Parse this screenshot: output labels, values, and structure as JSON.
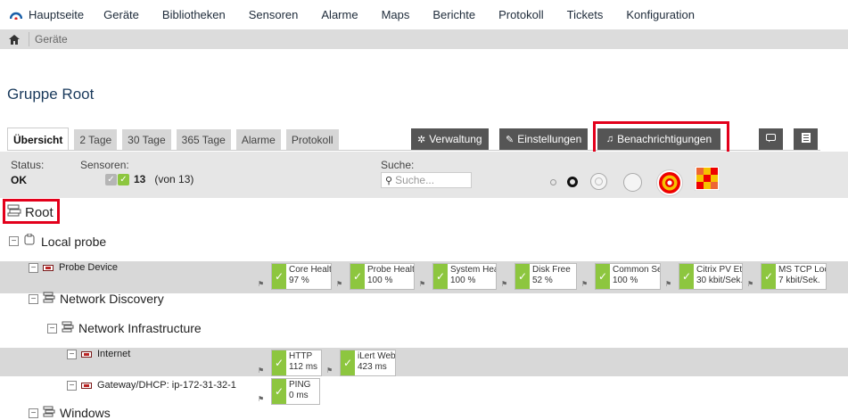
{
  "nav": {
    "items": [
      "Hauptseite",
      "Geräte",
      "Bibliotheken",
      "Sensoren",
      "Alarme",
      "Maps",
      "Berichte",
      "Protokoll",
      "Tickets",
      "Konfiguration"
    ]
  },
  "breadcrumb": {
    "current": "Geräte"
  },
  "page": {
    "title": "Gruppe Root"
  },
  "tabs": [
    {
      "label": "Übersicht"
    },
    {
      "label": "2 Tage"
    },
    {
      "label": "30 Tage"
    },
    {
      "label": "365 Tage"
    },
    {
      "label": "Alarme"
    },
    {
      "label": "Protokoll"
    }
  ],
  "actions": {
    "verwaltung": "Verwaltung",
    "einstellungen": "Einstellungen",
    "benachrichtigungen": "Benachrichtigungen"
  },
  "status": {
    "status_label": "Status:",
    "status_value": "OK",
    "sensors_label": "Sensoren:",
    "sensors_count": "13",
    "sensors_total": "(von 13)",
    "search_label": "Suche:",
    "search_placeholder": "Suche..."
  },
  "tree": {
    "root": "Root",
    "local_probe": "Local probe",
    "probe_device": "Probe Device",
    "network_discovery": "Network Discovery",
    "network_infrastructure": "Network Infrastructure",
    "internet": "Internet",
    "gateway": "Gateway/DHCP: ip-172-31-32-1",
    "windows": "Windows"
  },
  "sensors": {
    "probe_device": [
      {
        "name": "Core Health",
        "value": "97 %"
      },
      {
        "name": "Probe Health",
        "value": "100 %"
      },
      {
        "name": "System Health",
        "value": "100 %"
      },
      {
        "name": "Disk Free",
        "value": "52 %"
      },
      {
        "name": "Common Sea...",
        "value": "100 %"
      },
      {
        "name": "Citrix PV Eth...",
        "value": "30 kbit/Sek."
      },
      {
        "name": "MS TCP Loop...",
        "value": "7 kbit/Sek."
      }
    ],
    "internet": [
      {
        "name": "HTTP",
        "value": "112 ms"
      },
      {
        "name": "iLert Website",
        "value": "423 ms"
      }
    ],
    "gateway": [
      {
        "name": "PING",
        "value": "0 ms"
      }
    ]
  },
  "colors": {
    "ok_green": "#8dc63f",
    "highlight_red": "#e3001b",
    "dark_button": "#555555"
  }
}
